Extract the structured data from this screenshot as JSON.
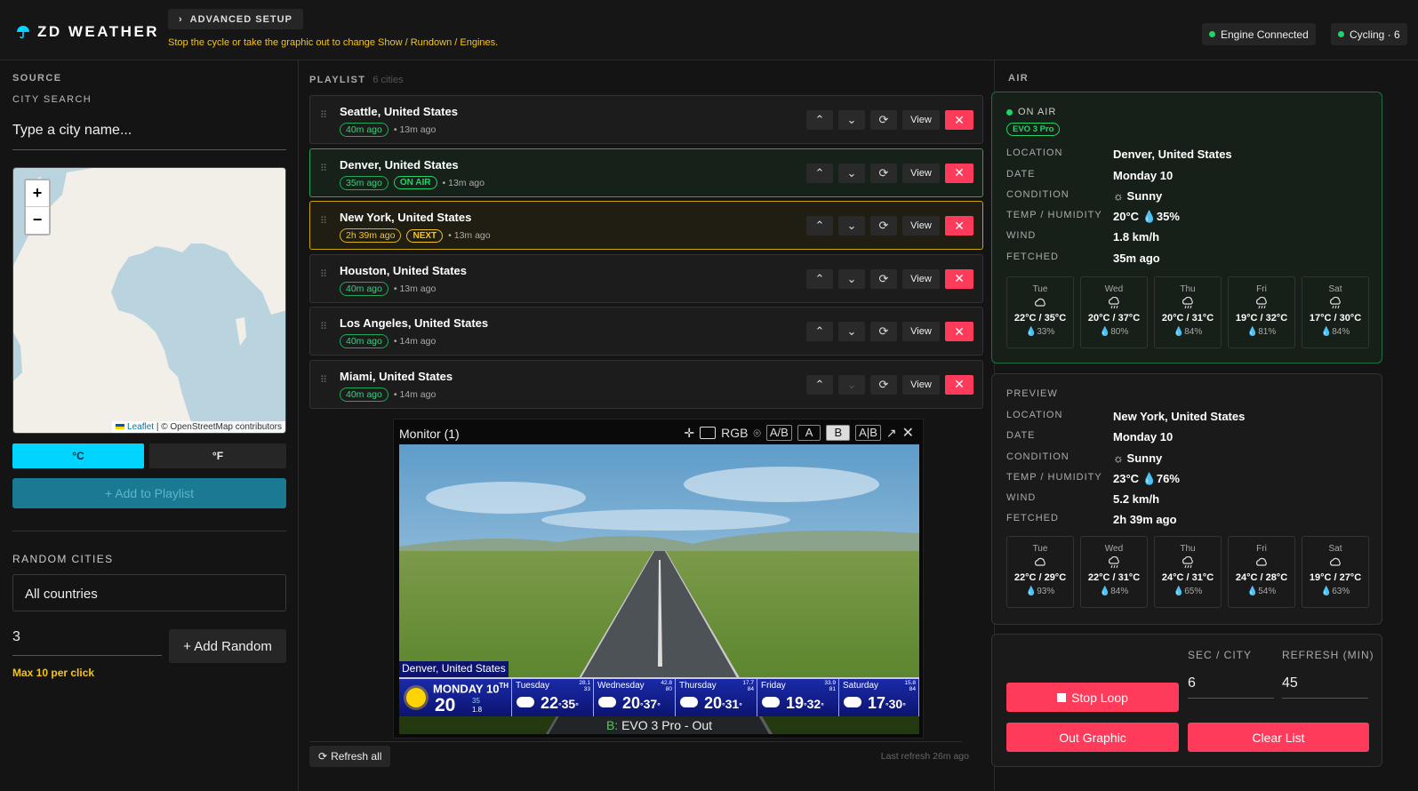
{
  "header": {
    "logo": "ZD WEATHER",
    "advanced_setup": "ADVANCED SETUP",
    "advanced_msg": "Stop the cycle or take the graphic out to change Show / Rundown / Engines.",
    "engine_status": "Engine Connected",
    "cycle_status": "Cycling · 6"
  },
  "source": {
    "section": "SOURCE",
    "city_search_label": "CITY SEARCH",
    "city_placeholder": "Type a city name...",
    "map_attribution_link": "Leaflet",
    "map_attribution_rest": " | © OpenStreetMap contributors",
    "zoom_in": "+",
    "zoom_out": "−",
    "unit_c": "°C",
    "unit_f": "°F",
    "add_to_playlist": "+ Add to Playlist",
    "random_label": "RANDOM CITIES",
    "countries": "All countries",
    "random_count": "3",
    "add_random": "+ Add Random",
    "max_note": "Max 10 per click"
  },
  "playlist": {
    "label": "PLAYLIST",
    "count": "6 cities",
    "view": "View",
    "rows": [
      {
        "name": "Seattle, United States",
        "age": "40m ago",
        "tag": "",
        "updated": "13m ago"
      },
      {
        "name": "Denver, United States",
        "age": "35m ago",
        "tag": "ON AIR",
        "updated": "13m ago"
      },
      {
        "name": "New York, United States",
        "age": "2h 39m ago",
        "tag": "NEXT",
        "updated": "13m ago"
      },
      {
        "name": "Houston, United States",
        "age": "40m ago",
        "tag": "",
        "updated": "13m ago"
      },
      {
        "name": "Los Angeles, United States",
        "age": "40m ago",
        "tag": "",
        "updated": "14m ago"
      },
      {
        "name": "Miami, United States",
        "age": "40m ago",
        "tag": "",
        "updated": "14m ago"
      }
    ],
    "refresh_all": "Refresh all",
    "last_refresh": "Last refresh 26m ago"
  },
  "monitor": {
    "title": "Monitor (1)",
    "tools": [
      "RGB",
      "A/B",
      "A",
      "B",
      "A|B"
    ],
    "out_prefix": "B:",
    "out_label": " EVO 3 Pro - Out",
    "city": "Denver, United States",
    "today_day": "MONDAY 10",
    "today_sup": "TH",
    "today_temp": "20",
    "today_hum": "35",
    "today_wind": "1.8",
    "days": [
      {
        "day": "Tuesday",
        "lo": "22",
        "hi": "35",
        "a": "28.1",
        "b": "33"
      },
      {
        "day": "Wednesday",
        "lo": "20",
        "hi": "37",
        "a": "42.8",
        "b": "80"
      },
      {
        "day": "Thursday",
        "lo": "20",
        "hi": "31",
        "a": "17.7",
        "b": "84"
      },
      {
        "day": "Friday",
        "lo": "19",
        "hi": "32",
        "a": "33.9",
        "b": "81"
      },
      {
        "day": "Saturday",
        "lo": "17",
        "hi": "30",
        "a": "15.8",
        "b": "84"
      }
    ]
  },
  "air": {
    "section": "AIR",
    "status": "ON AIR",
    "engine": "EVO 3 Pro",
    "labels": {
      "location": "LOCATION",
      "date": "DATE",
      "condition": "CONDITION",
      "temp": "TEMP / HUMIDITY",
      "wind": "WIND",
      "fetched": "FETCHED"
    },
    "location": "Denver, United States",
    "date": "Monday 10",
    "condition": "Sunny",
    "temp": "20°C",
    "humidity": "35%",
    "wind": "1.8 km/h",
    "fetched": "35m ago",
    "forecast": [
      {
        "day": "Tue",
        "icon": "cloud-icon",
        "range": "22°C / 35°C",
        "hum": "33%"
      },
      {
        "day": "Wed",
        "icon": "rain-icon",
        "range": "20°C / 37°C",
        "hum": "80%"
      },
      {
        "day": "Thu",
        "icon": "rain-icon",
        "range": "20°C / 31°C",
        "hum": "84%"
      },
      {
        "day": "Fri",
        "icon": "rain-icon",
        "range": "19°C / 32°C",
        "hum": "81%"
      },
      {
        "day": "Sat",
        "icon": "rain-icon",
        "range": "17°C / 30°C",
        "hum": "84%"
      }
    ]
  },
  "preview": {
    "section": "PREVIEW",
    "location": "New York, United States",
    "date": "Monday 10",
    "condition": "Sunny",
    "temp": "23°C",
    "humidity": "76%",
    "wind": "5.2 km/h",
    "fetched": "2h 39m ago",
    "forecast": [
      {
        "day": "Tue",
        "icon": "cloud-icon",
        "range": "22°C / 29°C",
        "hum": "93%"
      },
      {
        "day": "Wed",
        "icon": "rain-icon",
        "range": "22°C / 31°C",
        "hum": "84%"
      },
      {
        "day": "Thu",
        "icon": "rain-icon",
        "range": "24°C / 31°C",
        "hum": "65%"
      },
      {
        "day": "Fri",
        "icon": "cloud-icon",
        "range": "24°C / 28°C",
        "hum": "54%"
      },
      {
        "day": "Sat",
        "icon": "cloud-icon",
        "range": "19°C / 27°C",
        "hum": "63%"
      }
    ]
  },
  "controls": {
    "sec_label": "SEC / CITY",
    "refresh_label": "REFRESH (MIN)",
    "sec_value": "6",
    "refresh_value": "45",
    "stop_loop": "Stop Loop",
    "out_graphic": "Out Graphic",
    "clear_list": "Clear List"
  },
  "colors": {
    "accent": "#00d4ff",
    "onair": "#22d36b",
    "next": "#f5c518",
    "danger": "#ff3b5c"
  }
}
